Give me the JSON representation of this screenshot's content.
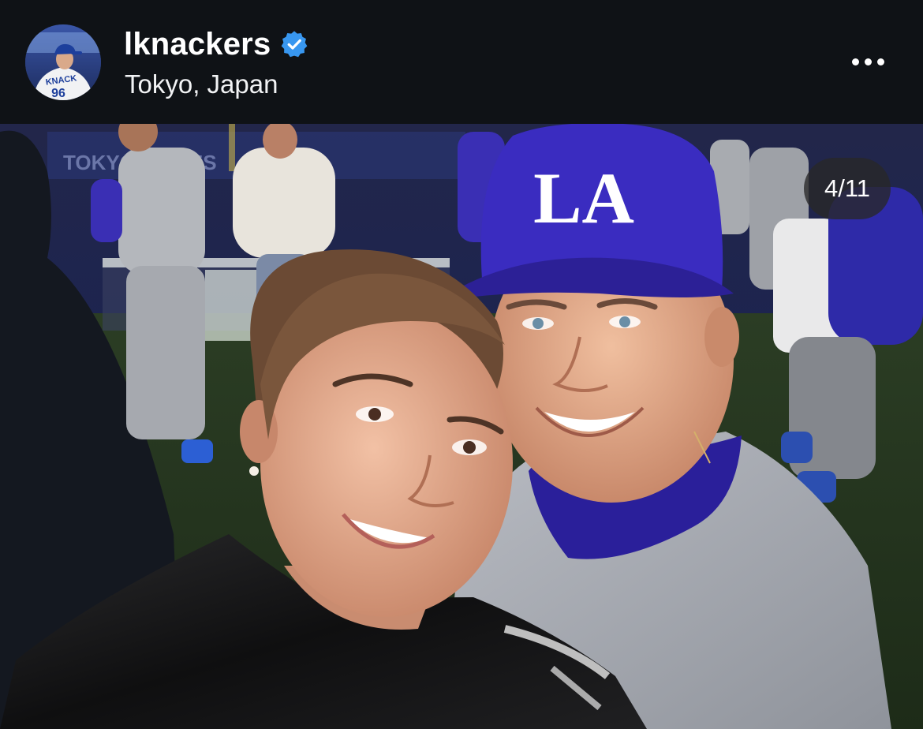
{
  "post": {
    "username": "lknackers",
    "verified": true,
    "location": "Tokyo, Japan",
    "avatar_jersey_text": "KNACK",
    "more_icon": "ellipsis-horizontal-icon",
    "verified_icon": "verified-badge-icon",
    "verified_color": "#3897f0",
    "media": {
      "counter": "4/11",
      "cap_logo": "LA",
      "description": "Selfie of a smiling couple on a baseball field; man in a blue LA cap and gray Dodgers uniform, woman in a black leather jacket"
    }
  },
  "colors": {
    "background": "#0f1216",
    "text_primary": "#ffffff",
    "badge_bg": "rgba(40,40,40,0.78)",
    "dodger_blue": "#3a2fb4"
  }
}
